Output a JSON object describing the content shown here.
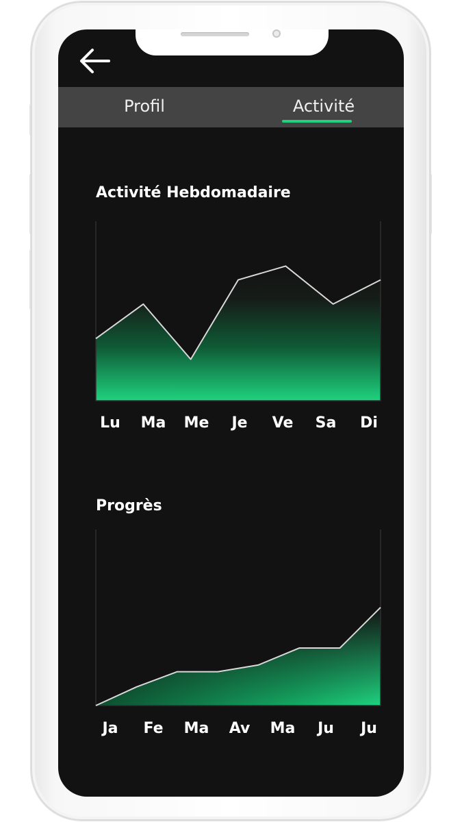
{
  "header": {
    "back_icon": "arrow-left-icon"
  },
  "tabs": [
    {
      "label": "Profil",
      "active": false
    },
    {
      "label": "Activité",
      "active": true
    }
  ],
  "colors": {
    "background": "#121212",
    "tab_bar": "#444444",
    "accent": "#1fd27f",
    "line": "#d9d9d9"
  },
  "chart_data": [
    {
      "type": "area",
      "title": "Activité Hebdomadaire",
      "categories": [
        "Lu",
        "Ma",
        "Me",
        "Je",
        "Ve",
        "Sa",
        "Di"
      ],
      "series": [
        {
          "values": [
            36,
            56,
            24,
            70,
            78,
            56,
            70
          ]
        }
      ],
      "ylim": [
        0,
        100
      ],
      "grid": false
    },
    {
      "type": "area",
      "title": "Progrès",
      "categories": [
        "Ja",
        "Fe",
        "Ma",
        "Av",
        "Ma",
        "Ju",
        "Ju"
      ],
      "series": [
        {
          "values": [
            0,
            11,
            20,
            20,
            24,
            34,
            34,
            58
          ]
        }
      ],
      "ylim": [
        0,
        100
      ],
      "grid": false
    }
  ]
}
